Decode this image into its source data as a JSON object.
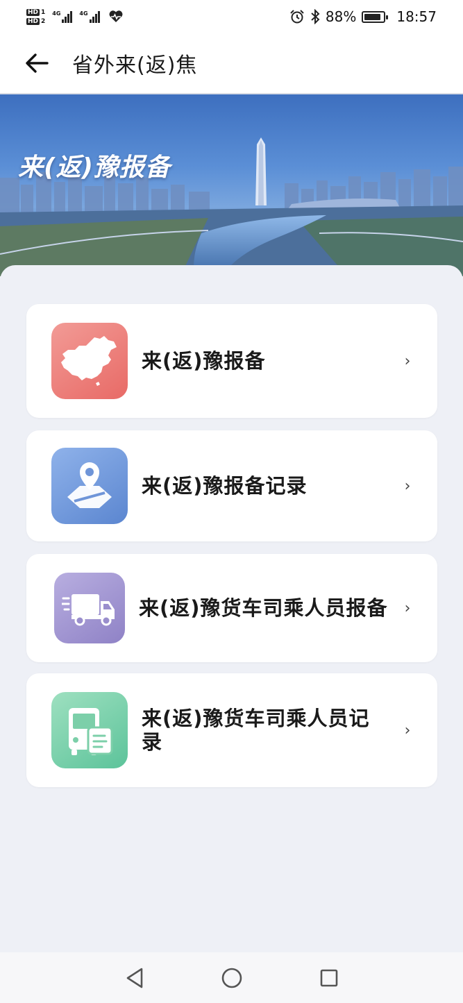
{
  "status_bar": {
    "sim1": "HD 1",
    "sim2": "HD 2",
    "network1": "4G",
    "network2": "4G",
    "battery_percent": "88%",
    "time": "18:57",
    "battery_level": 0.88,
    "icons": [
      "signal-icon",
      "heart-health-icon",
      "alarm-icon",
      "bluetooth-icon",
      "battery-icon"
    ]
  },
  "header": {
    "title": "省外来(返)焦",
    "back_icon": "arrow-left-icon"
  },
  "banner": {
    "title": "来(返)豫报备"
  },
  "menu": {
    "items": [
      {
        "label": "来(返)豫报备",
        "icon": "china-map-icon",
        "color": "#e86a66"
      },
      {
        "label": "来(返)豫报备记录",
        "icon": "map-pin-icon",
        "color": "#5b86d0"
      },
      {
        "label": "来(返)豫货车司乘人员报备",
        "icon": "truck-icon",
        "color": "#8f82c6"
      },
      {
        "label": "来(返)豫货车司乘人员记录",
        "icon": "bus-document-icon",
        "color": "#5cc39a"
      }
    ],
    "chevron": "›"
  },
  "nav": {
    "icons": [
      "back-triangle-icon",
      "home-circle-icon",
      "recents-square-icon"
    ]
  }
}
